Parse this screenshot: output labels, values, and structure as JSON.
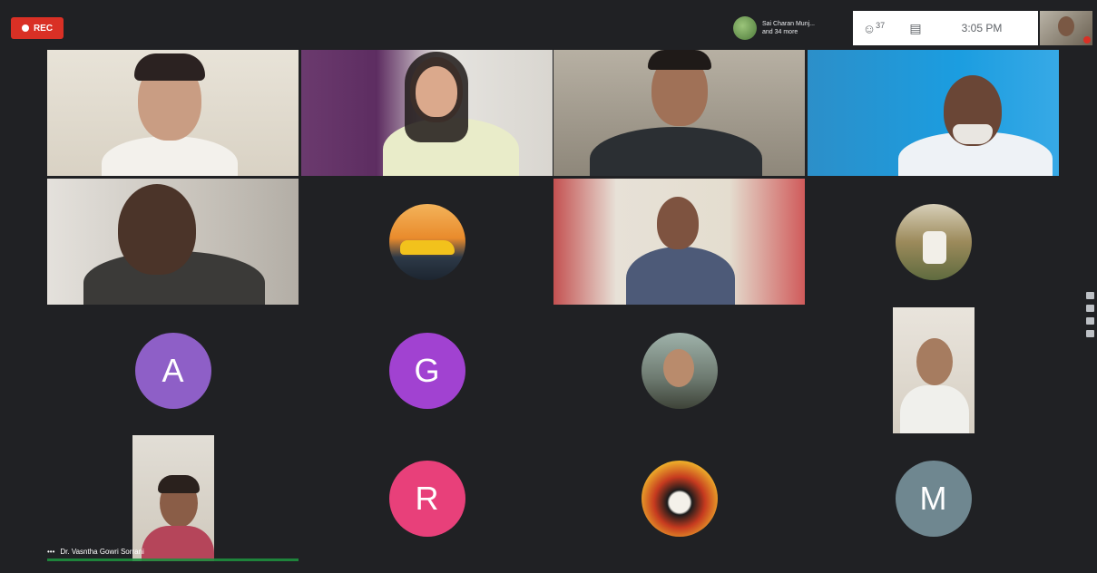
{
  "top_bar": {
    "rec_label": "REC",
    "presenter_line1": "Sai Charan Munj...",
    "presenter_line2": "and 34 more",
    "participants_icon": "people-icon",
    "participants_count": "37",
    "chat_icon": "chat-icon",
    "time": "3:05 PM"
  },
  "tiles": {
    "avatar_a": "A",
    "avatar_g": "G",
    "avatar_r": "R",
    "avatar_m": "M",
    "speaker_name": "Dr. Vasntha Gowri Sorrani"
  },
  "colors": {
    "avatar_a": "#8e5fc7",
    "avatar_g": "#a142d1",
    "avatar_r": "#e8407a",
    "avatar_m": "#6f8790",
    "rec": "#d93025",
    "speaking": "#1e8e3e"
  }
}
